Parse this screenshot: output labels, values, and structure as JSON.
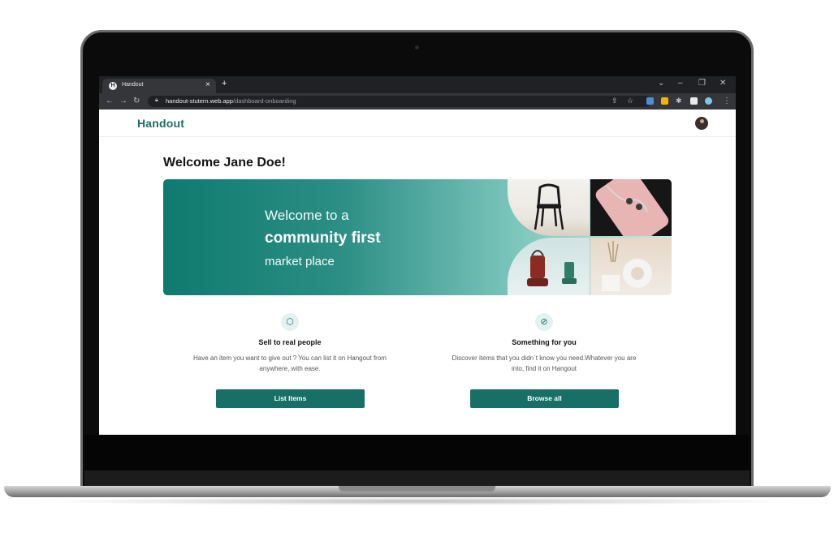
{
  "browser": {
    "tab_title": "Handout",
    "tab_favicon": "H",
    "url_host": "handout-stutern.web.app",
    "url_path": "/dashboard-onboarding"
  },
  "header": {
    "logo": "Handout"
  },
  "welcome": {
    "title": "Welcome Jane Doe!"
  },
  "hero": {
    "line1": "Welcome to a",
    "line2": "community first",
    "line3": "market place"
  },
  "features": [
    {
      "icon": "tag-icon",
      "title": "Sell to real people",
      "description": "Have an item you want to give out ? You can list it on Hangout from anywhere, with ease.",
      "button": "List Items"
    },
    {
      "icon": "compass-icon",
      "title": "Something for you",
      "description": "Discover items that you didn`t know you need.Whatever you are into, find it on Hangout",
      "button": "Browse all"
    }
  ],
  "colors": {
    "brand": "#186f66",
    "browser_chrome": "#202124"
  }
}
